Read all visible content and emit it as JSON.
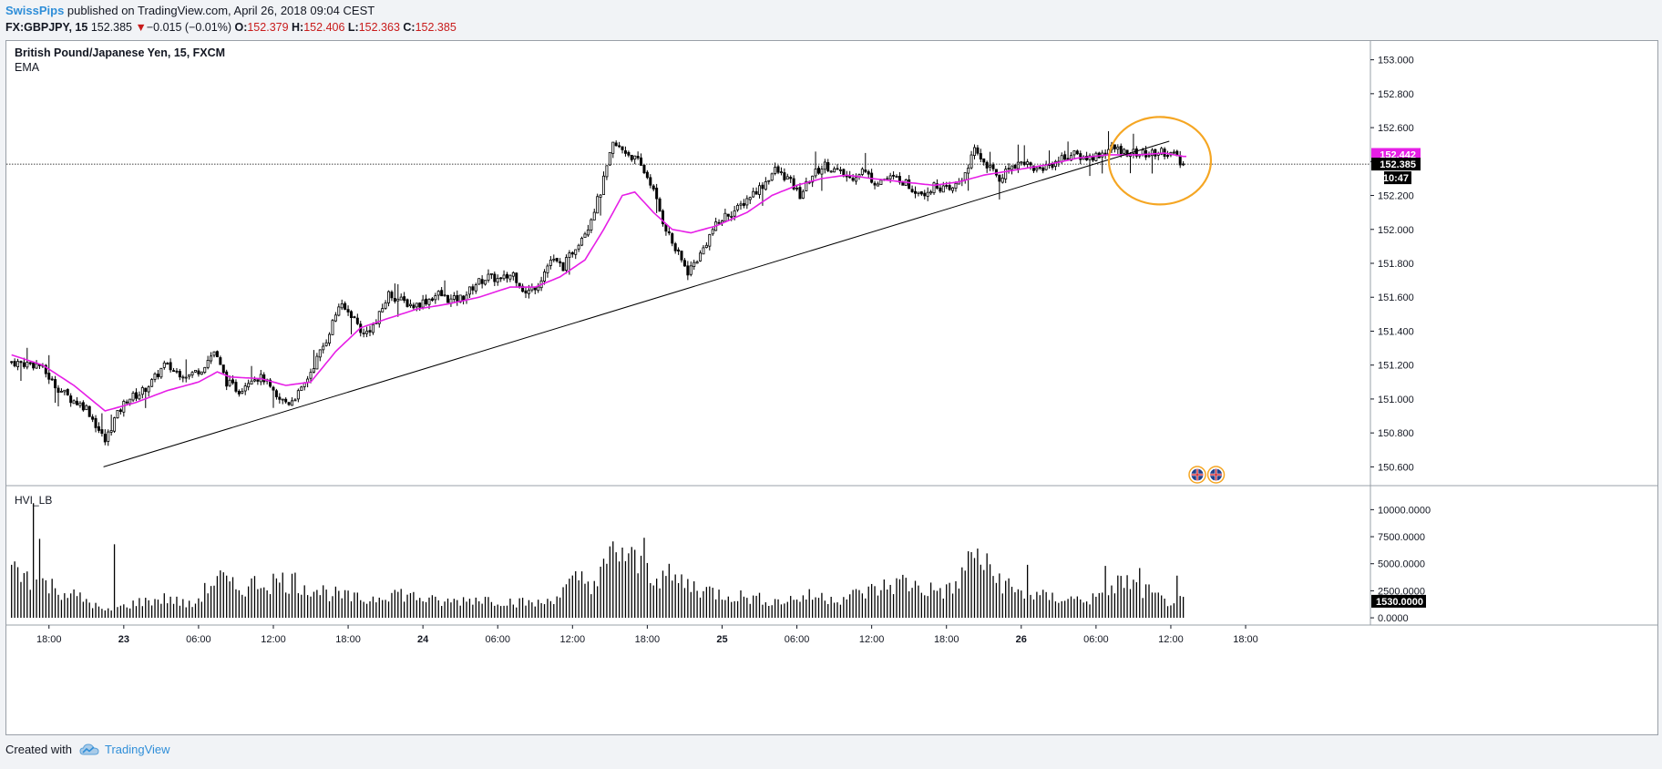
{
  "header": {
    "author": "SwissPips",
    "published": " published on TradingView.com, April 26, 2018 09:04 CEST",
    "symbol": "FX:GBPJPY, 15",
    "last": "152.385",
    "change_arrow": "▼",
    "change": "−0.015 (−0.01%)",
    "o_label": "O:",
    "o_value": "152.379",
    "h_label": "H:",
    "h_value": "152.406",
    "l_label": "L:",
    "l_value": "152.363",
    "c_label": "C:",
    "c_value": "152.385"
  },
  "footer": {
    "created_with": "Created with",
    "brand": "TradingView",
    "brand_icon": "cloud-logo-icon"
  },
  "colors": {
    "ema": "#e61ee6",
    "candle": "#000000",
    "volume": "#000000",
    "trendline": "#000000",
    "circle": "#f5a623",
    "grid": "#e6e9ee",
    "price_label_bg": "#000000",
    "ema_label_bg": "#e61ee6"
  },
  "chart_data": [
    {
      "type": "candlestick",
      "title": "British Pound/Japanese Yen, 15, FXCM",
      "indicator": "EMA",
      "ylim": [
        150.5,
        153.1
      ],
      "ytick_labels": [
        "153.000",
        "152.800",
        "152.600",
        "152.400",
        "152.200",
        "152.000",
        "151.800",
        "151.600",
        "151.400",
        "151.200",
        "151.000",
        "150.800",
        "150.600"
      ],
      "xtick_labels": [
        "18:00",
        "23",
        "06:00",
        "12:00",
        "18:00",
        "24",
        "06:00",
        "12:00",
        "18:00",
        "25",
        "06:00",
        "12:00",
        "18:00",
        "26",
        "06:00",
        "12:00",
        "18:00"
      ],
      "price_path": [
        [
          0,
          151.22
        ],
        [
          10,
          151.2
        ],
        [
          15,
          151.08
        ],
        [
          20,
          151.0
        ],
        [
          25,
          150.95
        ],
        [
          28,
          150.85
        ],
        [
          31,
          150.75
        ],
        [
          34,
          150.88
        ],
        [
          38,
          151.0
        ],
        [
          42,
          151.03
        ],
        [
          46,
          151.1
        ],
        [
          50,
          151.2
        ],
        [
          54,
          151.16
        ],
        [
          58,
          151.14
        ],
        [
          62,
          151.18
        ],
        [
          66,
          151.28
        ],
        [
          70,
          151.1
        ],
        [
          74,
          151.05
        ],
        [
          78,
          151.13
        ],
        [
          82,
          151.12
        ],
        [
          86,
          151.0
        ],
        [
          90,
          150.98
        ],
        [
          94,
          151.05
        ],
        [
          98,
          151.2
        ],
        [
          102,
          151.35
        ],
        [
          106,
          151.55
        ],
        [
          110,
          151.5
        ],
        [
          114,
          151.38
        ],
        [
          118,
          151.45
        ],
        [
          122,
          151.62
        ],
        [
          126,
          151.58
        ],
        [
          130,
          151.55
        ],
        [
          134,
          151.58
        ],
        [
          138,
          151.62
        ],
        [
          142,
          151.58
        ],
        [
          146,
          151.6
        ],
        [
          150,
          151.68
        ],
        [
          154,
          151.72
        ],
        [
          158,
          151.7
        ],
        [
          162,
          151.74
        ],
        [
          166,
          151.62
        ],
        [
          170,
          151.68
        ],
        [
          174,
          151.82
        ],
        [
          178,
          151.78
        ],
        [
          182,
          151.9
        ],
        [
          186,
          152.02
        ],
        [
          190,
          152.22
        ],
        [
          194,
          152.5
        ],
        [
          198,
          152.46
        ],
        [
          202,
          152.4
        ],
        [
          206,
          152.28
        ],
        [
          210,
          152.05
        ],
        [
          214,
          151.88
        ],
        [
          218,
          151.75
        ],
        [
          222,
          151.85
        ],
        [
          226,
          152.0
        ],
        [
          230,
          152.08
        ],
        [
          234,
          152.12
        ],
        [
          238,
          152.2
        ],
        [
          242,
          152.26
        ],
        [
          246,
          152.35
        ],
        [
          250,
          152.3
        ],
        [
          254,
          152.2
        ],
        [
          258,
          152.32
        ],
        [
          262,
          152.38
        ],
        [
          266,
          152.34
        ],
        [
          270,
          152.3
        ],
        [
          274,
          152.35
        ],
        [
          278,
          152.28
        ],
        [
          282,
          152.3
        ],
        [
          286,
          152.3
        ],
        [
          290,
          152.24
        ],
        [
          294,
          152.22
        ],
        [
          298,
          152.26
        ],
        [
          302,
          152.22
        ],
        [
          306,
          152.3
        ],
        [
          310,
          152.46
        ],
        [
          314,
          152.38
        ],
        [
          318,
          152.3
        ],
        [
          322,
          152.38
        ],
        [
          326,
          152.4
        ],
        [
          330,
          152.35
        ],
        [
          334,
          152.38
        ],
        [
          338,
          152.42
        ],
        [
          342,
          152.44
        ],
        [
          346,
          152.42
        ],
        [
          350,
          152.44
        ],
        [
          354,
          152.48
        ],
        [
          358,
          152.46
        ],
        [
          362,
          152.45
        ],
        [
          366,
          152.44
        ],
        [
          370,
          152.46
        ],
        [
          374,
          152.44
        ],
        [
          376,
          152.385
        ]
      ],
      "ema": [
        [
          0,
          151.26
        ],
        [
          10,
          151.2
        ],
        [
          20,
          151.08
        ],
        [
          30,
          150.93
        ],
        [
          40,
          150.98
        ],
        [
          50,
          151.05
        ],
        [
          60,
          151.1
        ],
        [
          66,
          151.16
        ],
        [
          70,
          151.13
        ],
        [
          80,
          151.12
        ],
        [
          88,
          151.08
        ],
        [
          96,
          151.1
        ],
        [
          104,
          151.28
        ],
        [
          112,
          151.42
        ],
        [
          120,
          151.47
        ],
        [
          130,
          151.53
        ],
        [
          140,
          151.56
        ],
        [
          150,
          151.6
        ],
        [
          160,
          151.66
        ],
        [
          168,
          151.66
        ],
        [
          176,
          151.72
        ],
        [
          184,
          151.82
        ],
        [
          190,
          152.0
        ],
        [
          196,
          152.2
        ],
        [
          200,
          152.22
        ],
        [
          206,
          152.1
        ],
        [
          212,
          152.0
        ],
        [
          218,
          151.98
        ],
        [
          226,
          152.02
        ],
        [
          236,
          152.1
        ],
        [
          244,
          152.2
        ],
        [
          252,
          152.26
        ],
        [
          260,
          152.3
        ],
        [
          268,
          152.32
        ],
        [
          276,
          152.3
        ],
        [
          286,
          152.28
        ],
        [
          296,
          152.26
        ],
        [
          304,
          152.28
        ],
        [
          312,
          152.32
        ],
        [
          322,
          152.35
        ],
        [
          332,
          152.38
        ],
        [
          342,
          152.42
        ],
        [
          352,
          152.44
        ],
        [
          362,
          152.44
        ],
        [
          370,
          152.45
        ],
        [
          376,
          152.43
        ]
      ],
      "candle_count": 377,
      "trendline": {
        "start": [
          0,
          150.6
        ],
        "end": [
          382,
          152.52
        ]
      },
      "last_price": "152.385",
      "ema_last": "152.442",
      "countdown": "10:47",
      "highlight": "orange-ellipse-around-latest-candles"
    },
    {
      "type": "bar",
      "title": "HVI_LB",
      "ylim": [
        -500,
        11800
      ],
      "ytick_labels": [
        "10000.0000",
        "7500.0000",
        "5000.0000",
        "2500.0000",
        "0.0000"
      ],
      "last_value": "1530.0000",
      "volume_profile": [
        [
          0,
          4500
        ],
        [
          8,
          3500
        ],
        [
          16,
          2500
        ],
        [
          24,
          1600
        ],
        [
          30,
          600
        ],
        [
          34,
          900
        ],
        [
          40,
          1400
        ],
        [
          50,
          1800
        ],
        [
          58,
          1100
        ],
        [
          66,
          3800
        ],
        [
          72,
          2600
        ],
        [
          80,
          3300
        ],
        [
          90,
          3400
        ],
        [
          98,
          2600
        ],
        [
          106,
          2000
        ],
        [
          114,
          1600
        ],
        [
          122,
          2400
        ],
        [
          130,
          1900
        ],
        [
          138,
          1400
        ],
        [
          150,
          1800
        ],
        [
          160,
          1500
        ],
        [
          170,
          1300
        ],
        [
          176,
          2200
        ],
        [
          182,
          3600
        ],
        [
          188,
          3200
        ],
        [
          194,
          6500
        ],
        [
          202,
          4500
        ],
        [
          210,
          3800
        ],
        [
          218,
          3000
        ],
        [
          226,
          2300
        ],
        [
          236,
          1900
        ],
        [
          246,
          1500
        ],
        [
          256,
          2000
        ],
        [
          266,
          1800
        ],
        [
          276,
          2500
        ],
        [
          286,
          3300
        ],
        [
          294,
          2600
        ],
        [
          302,
          2500
        ],
        [
          308,
          5500
        ],
        [
          314,
          4300
        ],
        [
          322,
          2400
        ],
        [
          332,
          1900
        ],
        [
          342,
          1700
        ],
        [
          350,
          1800
        ],
        [
          356,
          3400
        ],
        [
          362,
          2800
        ],
        [
          370,
          1500
        ],
        [
          376,
          1530
        ]
      ],
      "volume_spikes": [
        [
          7,
          10600
        ],
        [
          9,
          7300
        ],
        [
          33,
          6800
        ],
        [
          203,
          7400
        ],
        [
          310,
          6400
        ],
        [
          326,
          4900
        ],
        [
          351,
          4800
        ],
        [
          362,
          4600
        ],
        [
          374,
          3900
        ]
      ]
    }
  ]
}
